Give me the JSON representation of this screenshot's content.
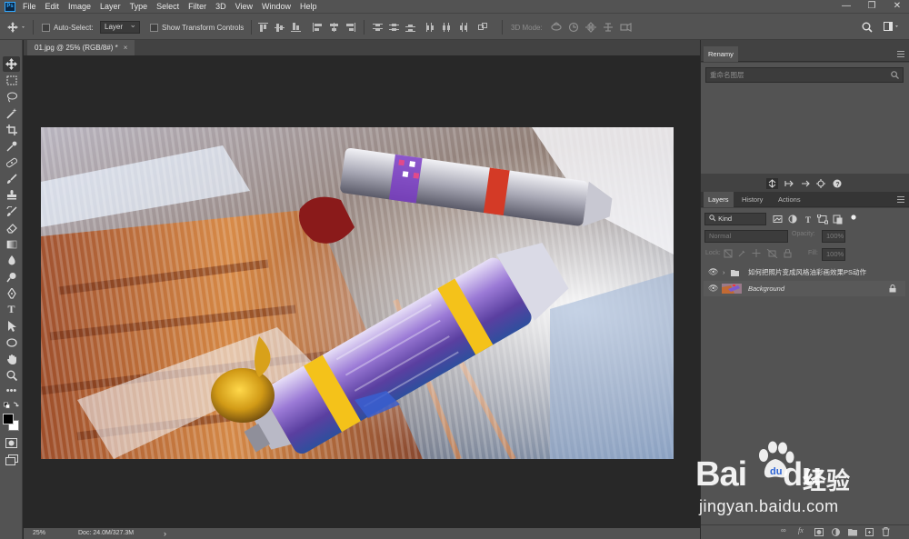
{
  "app": {
    "logo_text": "Ps",
    "menu": [
      "File",
      "Edit",
      "Image",
      "Layer",
      "Type",
      "Select",
      "Filter",
      "3D",
      "View",
      "Window",
      "Help"
    ],
    "window_controls": [
      "—",
      "❐",
      "✕"
    ]
  },
  "options_bar": {
    "auto_select_label": "Auto-Select:",
    "auto_select_target": "Layer",
    "transform_controls_label": "Show Transform Controls",
    "mode_3d_label": "3D Mode:"
  },
  "document": {
    "tab_title": "01.jpg @ 25% (RGB/8#) *",
    "close_glyph": "×",
    "zoom": "25%",
    "doc_size": "Doc: 24.0M/327.3M",
    "status_arrow": "›"
  },
  "renamy_panel": {
    "title": "Renamy",
    "search_placeholder": "重命名图层"
  },
  "layers_panel": {
    "tabs": [
      "Layers",
      "History",
      "Actions"
    ],
    "filter_kind": "Kind",
    "blend_mode": "Normal",
    "opacity_label": "Opacity:",
    "opacity_value": "100%",
    "lock_label": "Lock:",
    "fill_label": "Fill:",
    "fill_value": "100%",
    "layers": [
      {
        "name": "如何把照片变成风格油彩画效果PS动作",
        "type": "group",
        "visible": true
      },
      {
        "name": "Background",
        "type": "image",
        "visible": true,
        "locked": true
      }
    ]
  },
  "watermark": {
    "logo_text": "Bai",
    "logo_text_2": "du",
    "logo_cn": "经验",
    "url": "jingyan.baidu.com"
  },
  "colors": {
    "accent_ps": "#31a8ff",
    "panel_bg": "#535353",
    "dark_bg": "#282828",
    "baidu_red": "#de2d1f"
  }
}
